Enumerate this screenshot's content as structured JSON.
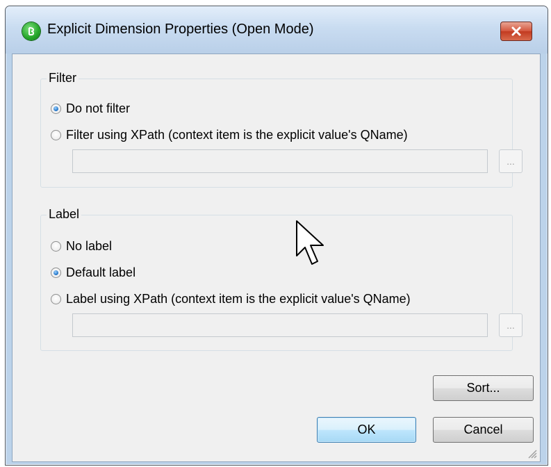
{
  "window": {
    "title": "Explicit Dimension Properties (Open Mode)"
  },
  "filter": {
    "legend": "Filter",
    "options": [
      {
        "label": "Do not filter",
        "selected": true
      },
      {
        "label": "Filter using XPath (context item is the explicit value's QName)",
        "selected": false
      }
    ],
    "xpath_value": "",
    "browse_label": "..."
  },
  "label": {
    "legend": "Label",
    "options": [
      {
        "label": "No label",
        "selected": false
      },
      {
        "label": "Default label",
        "selected": true
      },
      {
        "label": "Label using XPath (context item is the explicit value's QName)",
        "selected": false
      }
    ],
    "xpath_value": "",
    "browse_label": "..."
  },
  "buttons": {
    "sort": "Sort...",
    "ok": "OK",
    "cancel": "Cancel"
  },
  "colors": {
    "title_bar": "#c9dcf1",
    "close_button": "#c7452b",
    "ok_button_border": "#3c7fb1",
    "radio_selected": "#1b6fc4"
  },
  "icons": {
    "app": "xbrl-green-circle-icon",
    "close": "close-x-icon",
    "cursor": "mouse-pointer-icon",
    "resize": "resize-grip-icon"
  }
}
